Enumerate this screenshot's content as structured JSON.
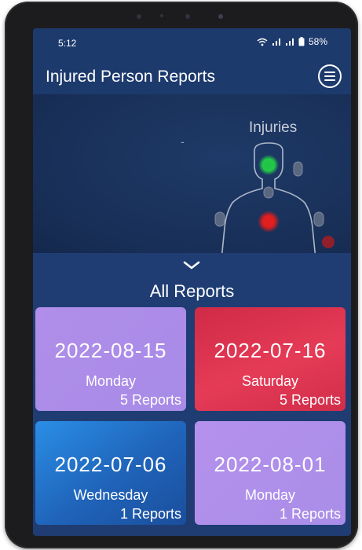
{
  "status_bar": {
    "time": "5:12",
    "battery": "58%",
    "icons": [
      "wifi-icon",
      "signal-icon",
      "signal-icon",
      "battery-icon"
    ]
  },
  "app_bar": {
    "title": "Injured Person Reports",
    "menu_icon": "menu-icon"
  },
  "injuries_panel": {
    "title": "Injuries",
    "dash": "-",
    "markers": [
      {
        "region": "head",
        "status": "green"
      },
      {
        "region": "chest",
        "status": "red"
      }
    ],
    "colors": {
      "ok": "#22c447",
      "injured": "#d91e1e",
      "neutral": "#4b5a74"
    }
  },
  "reports_panel": {
    "title": "All Reports",
    "collapse_icon": "chevron-down-icon",
    "cards": [
      {
        "date": "2022-08-15",
        "day": "Monday",
        "count": "5 Reports",
        "color": "#a98ce8"
      },
      {
        "date": "2022-07-16",
        "day": "Saturday",
        "count": "5 Reports",
        "color": "#e33a55"
      },
      {
        "date": "2022-07-06",
        "day": "Wednesday",
        "count": "1 Reports",
        "color": "#2579d0"
      },
      {
        "date": "2022-08-01",
        "day": "Monday",
        "count": "1 Reports",
        "color": "#ad8fe9"
      }
    ]
  }
}
